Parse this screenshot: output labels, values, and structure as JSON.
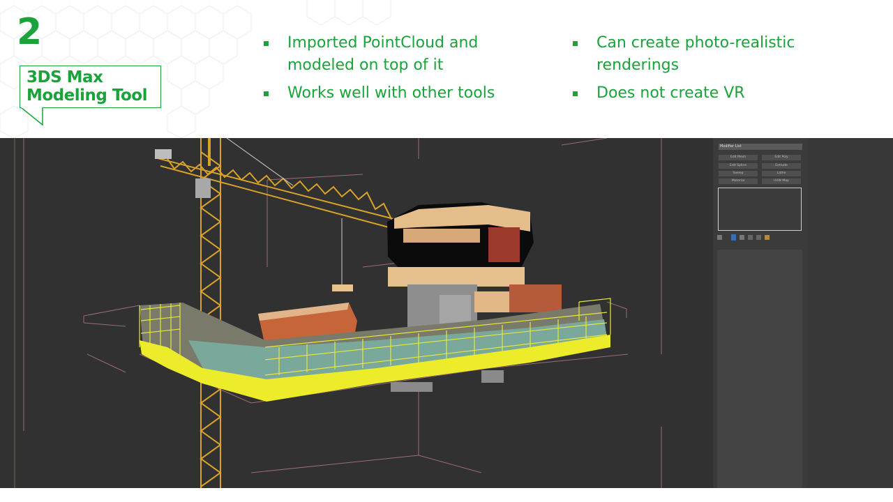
{
  "slide": {
    "number": "2",
    "title_line1": "3DS Max",
    "title_line2": "Modeling Tool"
  },
  "bullets_left": [
    {
      "line1": "Imported PointCloud and",
      "line2": "modeled on top of it"
    },
    {
      "line1": "Works well with other tools",
      "line2": ""
    }
  ],
  "bullets_right": [
    {
      "line1": "Can create photo-realistic",
      "line2": "renderings"
    },
    {
      "line1": "Does not create VR",
      "line2": ""
    }
  ],
  "app_panel": {
    "modifier_list": "Modifier List",
    "buttons": [
      "Edit Mesh",
      "Edit Poly",
      "Edit Spline",
      "Extrude",
      "Sweep",
      "Lathe",
      "Material",
      "UVW Map"
    ]
  },
  "colors": {
    "accent": "#1aa33a",
    "viewport_bg": "#313131",
    "crane": "#d9a32a",
    "safety_yellow": "#ecec2a"
  }
}
